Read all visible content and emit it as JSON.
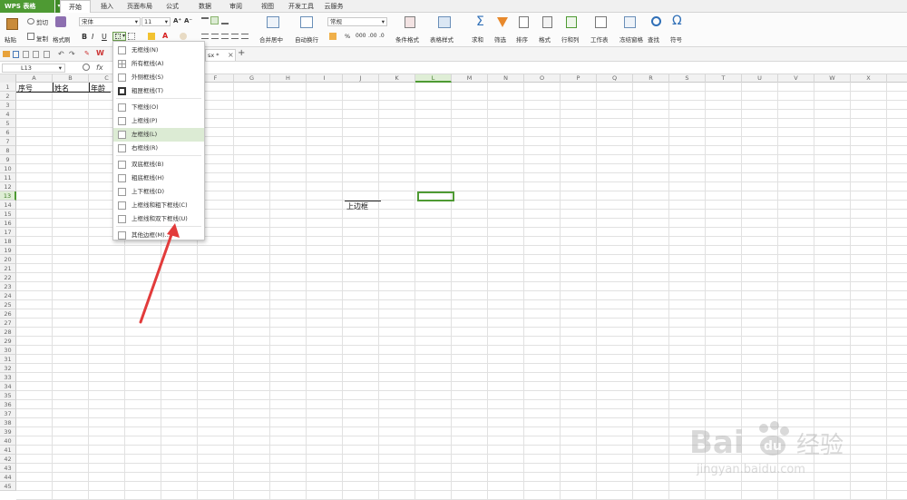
{
  "app": {
    "name": "WPS 表格",
    "caret": "▾"
  },
  "tabs": [
    "开始",
    "插入",
    "页面布局",
    "公式",
    "数据",
    "审阅",
    "视图",
    "开发工具",
    "云服务"
  ],
  "ribbon": {
    "paste": "粘贴",
    "cut": "剪切",
    "copy": "复制",
    "format_painter": "格式刷",
    "font_name": "宋体",
    "font_size": "11",
    "merge_center": "合并居中",
    "wrap_text": "自动换行",
    "number_format": "常规",
    "percent": "%",
    "conditional_format": "条件格式",
    "table_style": "表格样式",
    "sum": "求和",
    "filter": "筛选",
    "sort": "排序",
    "format": "格式",
    "rows_cols": "行和列",
    "worksheet": "工作表",
    "freeze": "冻结窗格",
    "find": "查找",
    "symbol": "符号",
    "bold": "B",
    "italic": "I",
    "underline": "U",
    "font_color": "A",
    "increase_font": "A⁺",
    "decrease_font": "A⁻"
  },
  "quickbar": {
    "doc_tab_suffix": "sx *",
    "close": "×",
    "add": "+"
  },
  "formula_bar": {
    "name_box": "L13",
    "fx": "fx"
  },
  "columns": [
    "A",
    "B",
    "C",
    "D",
    "E",
    "F",
    "G",
    "H",
    "I",
    "J",
    "K",
    "L",
    "M",
    "N",
    "O",
    "P",
    "Q",
    "R",
    "S",
    "T",
    "U",
    "V",
    "W",
    "X"
  ],
  "selected_column": "L",
  "selected_row": "13",
  "rows": [
    "1",
    "2",
    "3",
    "4",
    "5",
    "6",
    "7",
    "8",
    "9",
    "10",
    "11",
    "12",
    "13",
    "14",
    "15",
    "16",
    "17",
    "18",
    "19",
    "20",
    "21",
    "22",
    "23",
    "24",
    "25",
    "26",
    "27",
    "28",
    "29",
    "30",
    "31",
    "32",
    "33",
    "34",
    "35",
    "36",
    "37",
    "38",
    "39",
    "40",
    "41",
    "42",
    "43",
    "44",
    "45"
  ],
  "cells": {
    "A1": "序号",
    "B1": "姓名",
    "C1": "年龄",
    "J14": "上边框"
  },
  "border_menu": {
    "items": [
      "无框线(N)",
      "所有框线(A)",
      "外侧框线(S)",
      "粗匣框线(T)",
      "下框线(O)",
      "上框线(P)",
      "左框线(L)",
      "右框线(R)",
      "双底框线(B)",
      "粗底框线(H)",
      "上下框线(D)",
      "上框线和粗下框线(C)",
      "上框线和双下框线(U)",
      "其他边框(M)..."
    ],
    "highlighted": "左框线(L)"
  },
  "watermark": {
    "brand": "Bai",
    "brand2": "经验",
    "sub": "jingyan.baidu.com"
  },
  "colors": {
    "accent": "#4e9a33",
    "highlight": "#dcebd4",
    "arrow": "#e23b3b"
  }
}
